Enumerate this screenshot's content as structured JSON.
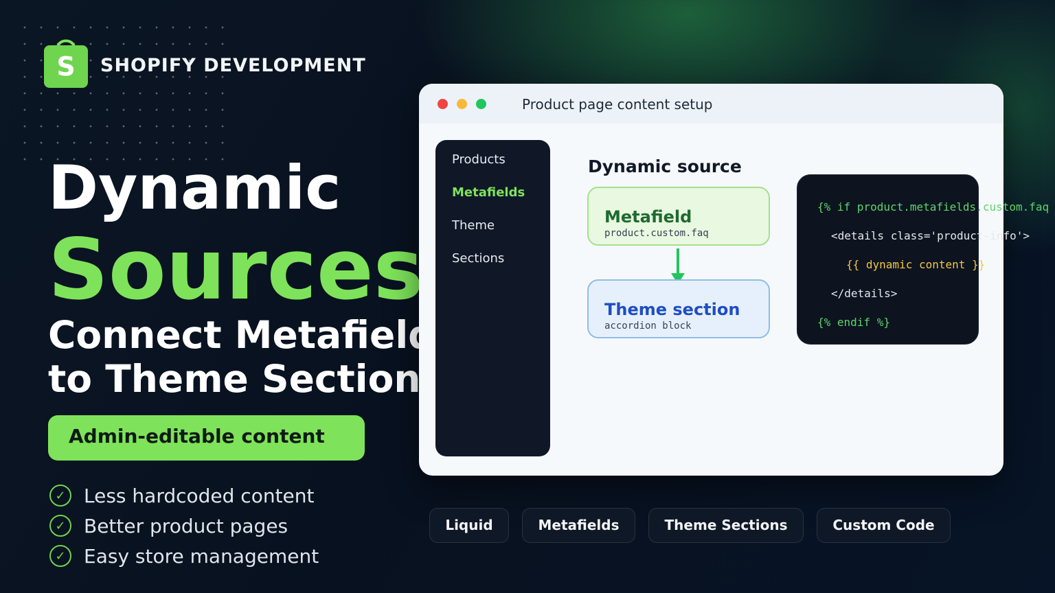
{
  "brand": {
    "logo_letter": "S",
    "logo_color": "#7ee35a",
    "text": "SHOPIFY DEVELOPMENT"
  },
  "hero": {
    "line1": "Dynamic",
    "line2": "Sources",
    "sub_line1": "Connect Metafields",
    "sub_line2": "to Theme Sections"
  },
  "pill": {
    "label": "Admin-editable content"
  },
  "bullets": [
    {
      "icon": "check-circle-icon",
      "text": "Less hardcoded content"
    },
    {
      "icon": "check-circle-icon",
      "text": "Better product pages"
    },
    {
      "icon": "check-circle-icon",
      "text": "Easy store management"
    }
  ],
  "window": {
    "title": "Product page content setup",
    "traffic_lights": [
      "#ef4444",
      "#f6b93b",
      "#22c55e"
    ],
    "sidebar": [
      {
        "label": "Products",
        "active": false
      },
      {
        "label": "Metafields",
        "active": true
      },
      {
        "label": "Theme",
        "active": false
      },
      {
        "label": "Sections",
        "active": false
      }
    ],
    "heading": "Dynamic source",
    "metafield_card": {
      "title": "Metafield",
      "sub": "product.custom.faq"
    },
    "theme_card": {
      "title": "Theme section",
      "sub": "accordion block"
    },
    "code": {
      "line1": "{% if product.metafields.custom.faq %}",
      "line2": "<details class='product-info'>",
      "line3": "{{ dynamic content }}",
      "line4": "</details>",
      "line5": "{% endif %}"
    }
  },
  "tags": [
    "Liquid",
    "Metafields",
    "Theme Sections",
    "Custom Code"
  ],
  "colors": {
    "accent_green": "#7ee35a",
    "background": "#08111f"
  }
}
